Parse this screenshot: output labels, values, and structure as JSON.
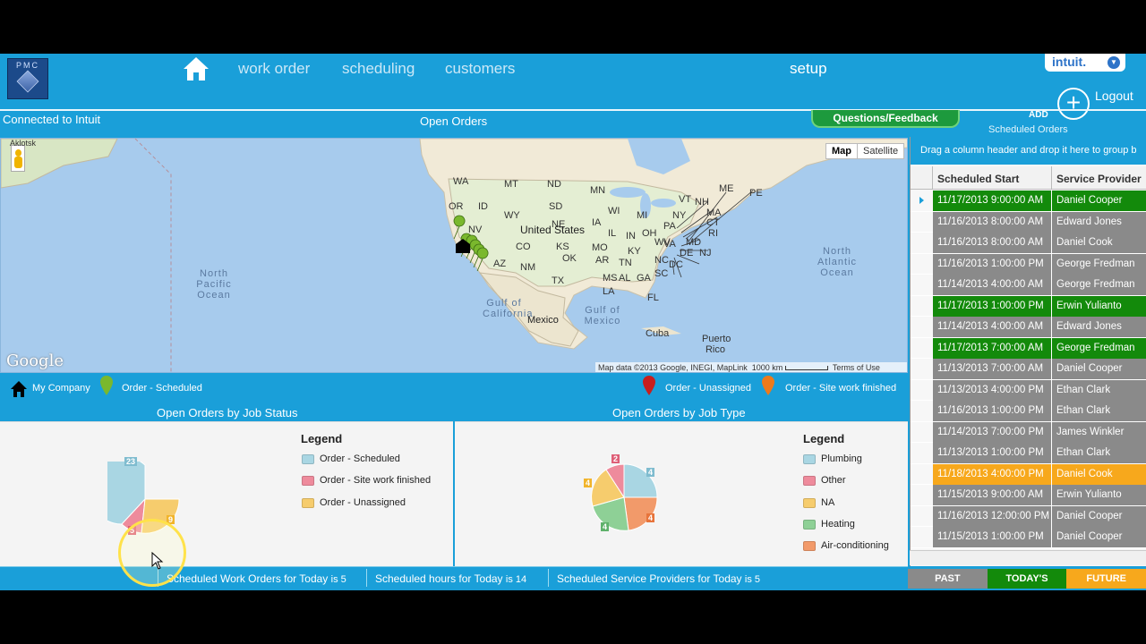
{
  "nav": {
    "logo_text": "PMC",
    "links": [
      "work order",
      "scheduling",
      "customers"
    ],
    "setup": "setup",
    "intuit_label": "intuit.",
    "logout": "Logout"
  },
  "subbar": {
    "connected": "Connected to Intuit",
    "open_orders": "Open Orders",
    "questions_feedback": "Questions/Feedback",
    "add": "ADD",
    "scheduled_orders": "Scheduled Orders"
  },
  "map": {
    "buttons": [
      "Map",
      "Satellite"
    ],
    "labels": [
      "Aklotsk",
      "WA",
      "MT",
      "ND",
      "MN",
      "OR",
      "ID",
      "SD",
      "WI",
      "MI",
      "NY",
      "VT",
      "NH",
      "ME",
      "MA",
      "PE",
      "NV",
      "WY",
      "NE",
      "IA",
      "IL",
      "IN",
      "OH",
      "PA",
      "CT",
      "RI",
      "NJ",
      "DE",
      "MD",
      "DC",
      "United States",
      "CO",
      "KS",
      "MO",
      "KY",
      "WV",
      "VA",
      "AZ",
      "NM",
      "OK",
      "AR",
      "TN",
      "NC",
      "SC",
      "MS",
      "AL",
      "GA",
      "TX",
      "LA",
      "FL",
      "Gulf of California",
      "Gulf of Mexico",
      "Mexico",
      "Cuba",
      "Puerto Rico"
    ],
    "oceans": [
      "North Pacific Ocean",
      "North Atlantic Ocean"
    ],
    "google": "Google",
    "attribution": "Map data ©2013 Google, INEGI, MapLink",
    "scale": "1000 km",
    "terms": "Terms of Use"
  },
  "legend_bar": {
    "my_company": "My Company",
    "scheduled": "Order - Scheduled",
    "unassigned": "Order - Unassigned",
    "site_work_finished": "Order - Site work finished"
  },
  "charts": {
    "status_title": "Open Orders by Job Status",
    "type_title": "Open Orders by Job Type",
    "legend_title": "Legend",
    "status_legend": [
      {
        "label": "Order - Scheduled",
        "color": "#a9d6e3"
      },
      {
        "label": "Order - Site work finished",
        "color": "#ee8b9c"
      },
      {
        "label": "Order - Unassigned",
        "color": "#f6cc6d"
      }
    ],
    "type_legend": [
      {
        "label": "Plumbing",
        "color": "#a9d6e3"
      },
      {
        "label": "Other",
        "color": "#ee8b9c"
      },
      {
        "label": "NA",
        "color": "#f6cc6d"
      },
      {
        "label": "Heating",
        "color": "#8ed096"
      },
      {
        "label": "Air-conditioning",
        "color": "#f29a6a"
      }
    ],
    "status_values": {
      "scheduled": "23",
      "site_work_finished": "5",
      "unassigned": "9"
    },
    "type_values": {
      "plumbing": "4",
      "other": "2",
      "na": "4",
      "heating": "4",
      "air_conditioning": "4"
    }
  },
  "status_bar": {
    "work_orders_label": "Scheduled Work Orders for Today",
    "work_orders_value": "is 5",
    "hours_label": "Scheduled hours for Today",
    "hours_value": "is 14",
    "providers_label": "Scheduled Service Providers for Today",
    "providers_value": "is 5"
  },
  "grid": {
    "group_hint": "Drag a column header and drop it here to group b",
    "columns": [
      "Scheduled Start",
      "Service Provider"
    ],
    "rows": [
      {
        "start": "11/17/2013 9:00:00 AM",
        "provider": "Daniel Cooper",
        "color": "#138a0b"
      },
      {
        "start": "11/16/2013 8:00:00 AM",
        "provider": "Edward Jones",
        "color": "#8a8a8a"
      },
      {
        "start": "11/16/2013 8:00:00 AM",
        "provider": "Daniel Cook",
        "color": "#8a8a8a"
      },
      {
        "start": "11/16/2013 1:00:00 PM",
        "provider": "George Fredman",
        "color": "#8a8a8a"
      },
      {
        "start": "11/14/2013 4:00:00 AM",
        "provider": "George Fredman",
        "color": "#8a8a8a"
      },
      {
        "start": "11/17/2013 1:00:00 PM",
        "provider": "Erwin Yulianto",
        "color": "#138a0b"
      },
      {
        "start": "11/14/2013 4:00:00 AM",
        "provider": "Edward Jones",
        "color": "#8a8a8a"
      },
      {
        "start": "11/17/2013 7:00:00 AM",
        "provider": "George Fredman",
        "color": "#138a0b"
      },
      {
        "start": "11/13/2013 7:00:00 AM",
        "provider": "Daniel Cooper",
        "color": "#8a8a8a"
      },
      {
        "start": "11/13/2013 4:00:00 PM",
        "provider": "Ethan Clark",
        "color": "#8a8a8a"
      },
      {
        "start": "11/16/2013 1:00:00 PM",
        "provider": "Ethan Clark",
        "color": "#8a8a8a"
      },
      {
        "start": "11/14/2013 7:00:00 PM",
        "provider": "James Winkler",
        "color": "#8a8a8a"
      },
      {
        "start": "11/13/2013 1:00:00 PM",
        "provider": "Ethan Clark",
        "color": "#8a8a8a"
      },
      {
        "start": "11/18/2013 4:00:00 PM",
        "provider": "Daniel Cook",
        "color": "#f7a81c"
      },
      {
        "start": "11/15/2013 9:00:00 AM",
        "provider": "Erwin Yulianto",
        "color": "#8a8a8a"
      },
      {
        "start": "11/16/2013 12:00:00 PM",
        "provider": "Daniel Cooper",
        "color": "#8a8a8a"
      },
      {
        "start": "11/15/2013 1:00:00 PM",
        "provider": "Daniel Cooper",
        "color": "#8a8a8a"
      }
    ],
    "time_tabs": [
      {
        "label": "PAST",
        "color": "#8a8a8a"
      },
      {
        "label": "TODAY'S",
        "color": "#138a0b"
      },
      {
        "label": "FUTURE",
        "color": "#f7a81c"
      }
    ]
  }
}
